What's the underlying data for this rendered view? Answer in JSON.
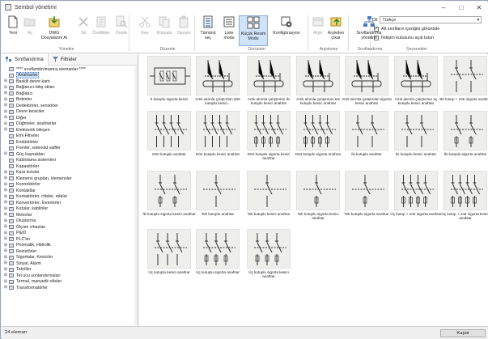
{
  "window": {
    "title": "Sembol yönetimi"
  },
  "ribbon": {
    "buttons": [
      {
        "label": "Yeni",
        "enabled": true,
        "icon": "new-doc-icon"
      },
      {
        "label": "Aç",
        "enabled": false,
        "icon": "open-folder-icon"
      },
      {
        "label": "DWG Dosyalarını Al",
        "enabled": true,
        "icon": "import-dwg-icon"
      },
      {
        "label": "Sil",
        "enabled": false,
        "icon": "delete-x-icon"
      },
      {
        "label": "Özellikler",
        "enabled": false,
        "icon": "properties-icon"
      },
      {
        "label": "Önizle",
        "enabled": false,
        "icon": "preview-magnifier-icon"
      },
      {
        "label": "Kes",
        "enabled": false,
        "icon": "cut-scissors-icon"
      },
      {
        "label": "Kopyala",
        "enabled": false,
        "icon": "copy-icon"
      },
      {
        "label": "Yapıştır",
        "enabled": false,
        "icon": "paste-icon"
      },
      {
        "label": "Tümünü seç",
        "enabled": true,
        "icon": "select-all-icon"
      },
      {
        "label": "Liste modu",
        "enabled": true,
        "icon": "list-mode-icon"
      },
      {
        "label": "Küçük Resim Modu",
        "enabled": true,
        "active": true,
        "icon": "thumbnail-mode-icon"
      },
      {
        "label": "Konfigürasyon",
        "enabled": true,
        "icon": "configuration-icon"
      },
      {
        "label": "Arşiv",
        "enabled": false,
        "icon": "archive-icon"
      },
      {
        "label": "Arşivden çıkar",
        "enabled": true,
        "icon": "unarchive-icon"
      },
      {
        "label": "Sınıflandırma yönetimi",
        "enabled": true,
        "icon": "classification-management-icon"
      }
    ],
    "groups": [
      "Yönetim",
      "Düzenle",
      "Görünüm",
      "Arşivleme",
      "Sınıflandırma",
      "Seçenekler"
    ],
    "language": {
      "label": "Dil",
      "value": "Türkçe"
    },
    "options": [
      {
        "label": "Alt sınıfların içeriğini görüntüle",
        "checked": true
      },
      {
        "label": "İletişim kutusunu açık tutun",
        "checked": false
      }
    ]
  },
  "left_panel": {
    "tabs": [
      "Sınıflandırma",
      "Filtreler"
    ],
    "tree": [
      {
        "label": "**** sınıflandırılmamış elemanlar ****",
        "expandable": false
      },
      {
        "label": "Anahtarlar",
        "expandable": false,
        "selected": true
      },
      {
        "label": "Baskili devre kartı",
        "expandable": true
      },
      {
        "label": "Bağlanıcı-bitiş okları",
        "expandable": true
      },
      {
        "label": "Bağlatıcı",
        "expandable": true
      },
      {
        "label": "Bobinler",
        "expandable": true
      },
      {
        "label": "Dedektörler, sensörler",
        "expandable": true
      },
      {
        "label": "Devre kesiciler",
        "expandable": true
      },
      {
        "label": "Diğer",
        "expandable": true
      },
      {
        "label": "Düğmeler, anahtarlar",
        "expandable": true
      },
      {
        "label": "Elektronik bileşen",
        "expandable": true
      },
      {
        "label": "Emi Filtreler",
        "expandable": false
      },
      {
        "label": "Endüktörler",
        "expandable": false
      },
      {
        "label": "Frenler, solenoid valfler",
        "expandable": false
      },
      {
        "label": "Güç kaynakları",
        "expandable": true
      },
      {
        "label": "Kablolama sistemleri",
        "expandable": false
      },
      {
        "label": "Kapasitörler",
        "expandable": false
      },
      {
        "label": "Kara kutular",
        "expandable": true
      },
      {
        "label": "Klemens grupları, klemensler",
        "expandable": true
      },
      {
        "label": "Konnektörler",
        "expandable": true
      },
      {
        "label": "Kontaktlar",
        "expandable": true
      },
      {
        "label": "Kontaktörler, röleler, roleler",
        "expandable": true
      },
      {
        "label": "Konvertörler, İnverterler",
        "expandable": true
      },
      {
        "label": "Kutular, kablinler",
        "expandable": true
      },
      {
        "label": "Motorlar",
        "expandable": true
      },
      {
        "label": "Oluşturma",
        "expandable": true
      },
      {
        "label": "Ölçüm cihazları",
        "expandable": true
      },
      {
        "label": "P&ID",
        "expandable": true
      },
      {
        "label": "PLC'ler",
        "expandable": true
      },
      {
        "label": "Pnömatik, Hidrolik",
        "expandable": true
      },
      {
        "label": "Rezistörler",
        "expandable": true
      },
      {
        "label": "Sigortalar, Kesiciler",
        "expandable": true
      },
      {
        "label": "Sinyal, Alarm",
        "expandable": true
      },
      {
        "label": "Tahriller",
        "expandable": true
      },
      {
        "label": "Tel ucu sonlandırmaları",
        "expandable": true
      },
      {
        "label": "Termal, manyetik röleler",
        "expandable": true
      },
      {
        "label": "Transformatörler",
        "expandable": true
      }
    ]
  },
  "symbols": [
    {
      "caption": "3 kutuplu sigorta kesici",
      "drawing": "box"
    },
    {
      "caption": "Artık akımla çalıştırılan dört kutuplu kesici...",
      "drawing": "loop"
    },
    {
      "caption": "Artık akımla çalıştırılan iki kutuplu kesici anahtar",
      "drawing": "loop"
    },
    {
      "caption": "Artık akımla çalıştırılan tek kutuplu kesici anahtar",
      "drawing": "loop"
    },
    {
      "caption": "Artık akımla çalıştırılan sigorta kesici anahtar",
      "drawing": "loop"
    },
    {
      "caption": "Artık akımla çalıştırılan üç kutuplu kesici anahtar",
      "drawing": "loop"
    },
    {
      "caption": "Bir kutup + nötr sigorta anahtar",
      "drawing": "poles2"
    },
    {
      "caption": "Dört kutuplu anahtar",
      "drawing": "poles4"
    },
    {
      "caption": "Dört kutuplu kesici anahtar",
      "drawing": "poles4"
    },
    {
      "caption": "Dört kutuplu sigorta kesici anahtar",
      "drawing": "poles4f"
    },
    {
      "caption": "Dört kutuplu sigorta anahtar",
      "drawing": "poles4f"
    },
    {
      "caption": "İki kutuplu anahtar",
      "drawing": "poles2"
    },
    {
      "caption": "İki kutuplu kesici anahtar",
      "drawing": "poles2"
    },
    {
      "caption": "İki kutuplu sigorta anahtar",
      "drawing": "poles2f"
    },
    {
      "caption": "İki kutuplu sigorta kesici anahtar",
      "drawing": "poles2f"
    },
    {
      "caption": "Tek kutuplu anahtar",
      "drawing": "poles1"
    },
    {
      "caption": "Tek kutuplu kesici anahtar",
      "drawing": "poles1"
    },
    {
      "caption": "Tek kutuplu sigorta kesici anahtar",
      "drawing": "poles1f"
    },
    {
      "caption": "Tek kutuplu sigorta anahtar",
      "drawing": "poles1f"
    },
    {
      "caption": "Üç kutup + nötr sigorta anahtar",
      "drawing": "poles4f"
    },
    {
      "caption": "Üç kutup + nötr sigorta kesici anahtar",
      "drawing": "poles4f"
    },
    {
      "caption": "Üç kutuplu kesici anahtar",
      "drawing": "poles3"
    },
    {
      "caption": "Üç kutuplu sigorta anahtar",
      "drawing": "poles3f"
    },
    {
      "caption": "Üç kutuplu sigorta kesici anahtar",
      "drawing": "poles3f"
    }
  ],
  "status": {
    "count_text": "24 eleman"
  },
  "footer": {
    "close_label": "Kapat"
  }
}
